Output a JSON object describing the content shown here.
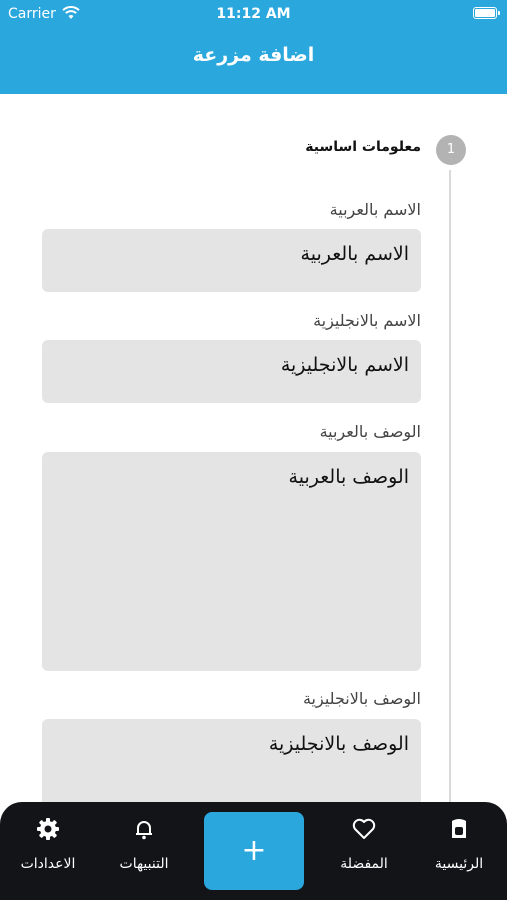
{
  "status_bar": {
    "carrier": "Carrier",
    "time": "11:12 AM"
  },
  "header": {
    "title": "اضافة مزرعة"
  },
  "stepper": {
    "step_number": "1",
    "step_title": "معلومات اساسية"
  },
  "form": {
    "name_ar": {
      "label": "الاسم بالعربية",
      "value": "الاسم بالعربية"
    },
    "name_en": {
      "label": "الاسم بالانجليزية",
      "value": "الاسم بالانجليزية"
    },
    "desc_ar": {
      "label": "الوصف بالعربية",
      "value": "الوصف بالعربية"
    },
    "desc_en": {
      "label": "الوصف بالانجليزية",
      "value": "الوصف بالانجليزية"
    }
  },
  "bottom_nav": {
    "home": "الرئيسية",
    "favorites": "المفضلة",
    "add": "+",
    "notifications": "التنبيهات",
    "settings": "الاعدادات"
  },
  "colors": {
    "accent": "#2aa7dd",
    "nav_bg": "#121418",
    "field_bg": "#e4e4e4"
  }
}
